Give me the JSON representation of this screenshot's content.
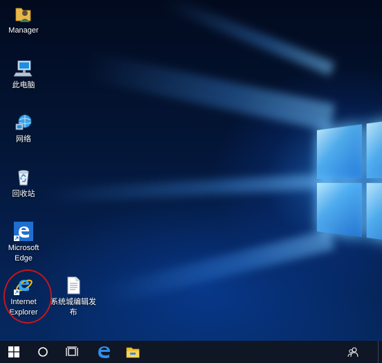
{
  "desktop": {
    "icons": [
      {
        "label": "Manager",
        "icon": "user-folder-icon"
      },
      {
        "label": "此电脑",
        "icon": "computer-icon"
      },
      {
        "label": "网络",
        "icon": "network-icon"
      },
      {
        "label": "回收站",
        "icon": "recycle-bin-icon"
      },
      {
        "label_line1": "Microsoft",
        "label_line2": "Edge",
        "icon": "edge-shortcut-icon"
      },
      {
        "label_line1": "Internet",
        "label_line2": "Explorer",
        "icon": "ie-shortcut-icon"
      },
      {
        "label_line1": "系统城编辑发",
        "label_line2": "布",
        "icon": "text-document-icon"
      }
    ],
    "highlight_color": "#c4161c"
  },
  "taskbar": {
    "items": [
      "start-icon",
      "cortana-search-icon",
      "task-view-icon",
      "edge-icon",
      "file-explorer-icon"
    ],
    "tray": [
      "people-icon"
    ],
    "accent": "#0078d7"
  }
}
